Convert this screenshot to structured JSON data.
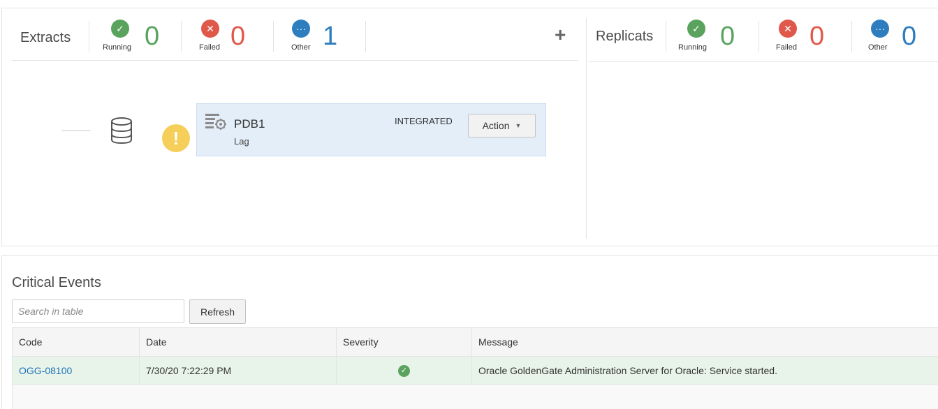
{
  "extracts": {
    "title": "Extracts",
    "running": {
      "label": "Running",
      "count": "0",
      "icon": "check-icon"
    },
    "failed": {
      "label": "Failed",
      "count": "0",
      "icon": "x-icon"
    },
    "other": {
      "label": "Other",
      "count": "1",
      "icon": "ellipsis-icon"
    },
    "add_label": "+",
    "process": {
      "name": "PDB1",
      "status": "Lag",
      "type": "INTEGRATED",
      "action_label": "Action",
      "warning_glyph": "!"
    }
  },
  "replicats": {
    "title": "Replicats",
    "running": {
      "label": "Running",
      "count": "0",
      "icon": "check-icon"
    },
    "failed": {
      "label": "Failed",
      "count": "0",
      "icon": "x-icon"
    },
    "other": {
      "label": "Other",
      "count": "0",
      "icon": "ellipsis-icon"
    }
  },
  "critical_events": {
    "title": "Critical Events",
    "search_placeholder": "Search in table",
    "refresh_label": "Refresh",
    "columns": [
      "Code",
      "Date",
      "Severity",
      "Message"
    ],
    "rows": [
      {
        "code": "OGG-08100",
        "date": "7/30/20 7:22:29 PM",
        "severity": "success",
        "message": "Oracle GoldenGate Administration Server for Oracle: Service started."
      }
    ]
  },
  "colors": {
    "running": "#5aa35f",
    "failed": "#e0584a",
    "other": "#2e7ebf",
    "warning": "#f5cf5a",
    "process_card": "#e3eef9",
    "event_row": "#e8f4ea"
  }
}
